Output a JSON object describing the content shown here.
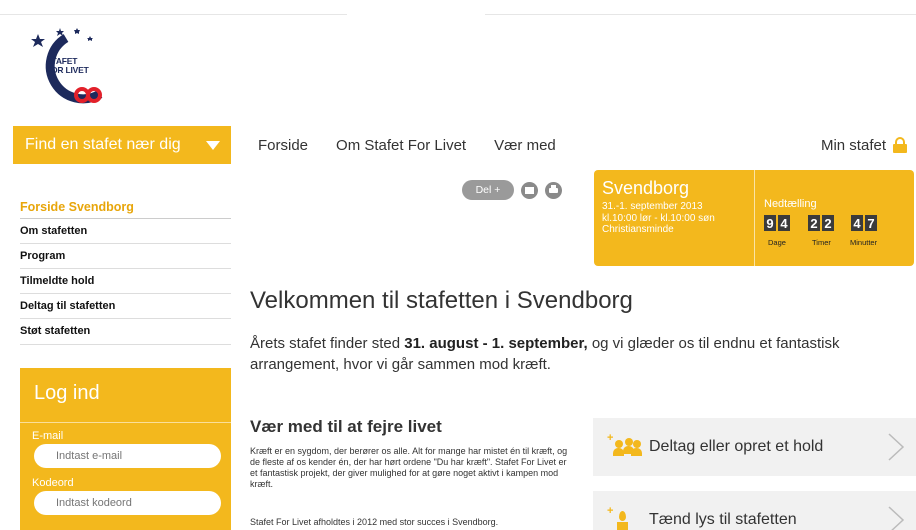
{
  "brand": {
    "logo_line1": "STAFET",
    "logo_line2": "FOR LIVET"
  },
  "header": {
    "find_button": "Find en stafet nær dig",
    "nav": [
      "Forside",
      "Om Stafet For Livet",
      "Vær med"
    ],
    "min_stafet": "Min stafet"
  },
  "sidebar": {
    "items": [
      {
        "label": "Forside Svendborg",
        "active": true
      },
      {
        "label": "Om stafetten"
      },
      {
        "label": "Program"
      },
      {
        "label": "Tilmeldte hold"
      },
      {
        "label": "Deltag til stafetten"
      },
      {
        "label": "Støt stafetten"
      }
    ]
  },
  "login": {
    "title": "Log ind",
    "email_label": "E-mail",
    "email_placeholder": "Indtast e-mail",
    "password_label": "Kodeord",
    "password_placeholder": "Indtast kodeord"
  },
  "share": {
    "del_label": "Del +"
  },
  "event": {
    "city": "Svendborg",
    "dates": "31.-1. september 2013",
    "times": "kl.10:00 lør - kl.10:00 søn",
    "place": "Christiansminde",
    "countdown_label": "Nedtælling",
    "days_digits": [
      "9",
      "4"
    ],
    "hours_digits": [
      "2",
      "2"
    ],
    "minutes_digits": [
      "4",
      "7"
    ],
    "days_label": "Dage",
    "hours_label": "Timer",
    "minutes_label": "Minutter"
  },
  "main": {
    "heading": "Velkommen til stafetten i Svendborg",
    "intro_pre": "Årets stafet finder sted ",
    "intro_bold": "31. august - 1. september,",
    "intro_post": " og vi glæder os til endnu et fantastisk arrangement, hvor vi går sammen mod kræft.",
    "subheading": "Vær med til at fejre livet",
    "paragraph": "Kræft er en sygdom, der berører os alle. Alt for mange har mistet én til kræft, og de fleste af os kender én, der har hørt ordene \"Du har kræft\". Stafet For Livet er et fantastisk projekt, der giver mulighed for at gøre noget aktivt i kampen mod kræft.",
    "paragraph2": "Stafet For Livet afholdtes i 2012 med stor succes i Svendborg."
  },
  "cta": [
    {
      "label": "Deltag eller opret et hold",
      "icon": "people-icon"
    },
    {
      "label": "Tænd lys til stafetten",
      "icon": "candle-icon"
    }
  ],
  "colors": {
    "accent": "#f3b81d",
    "navy": "#1d2a5c",
    "red": "#e2202a"
  }
}
